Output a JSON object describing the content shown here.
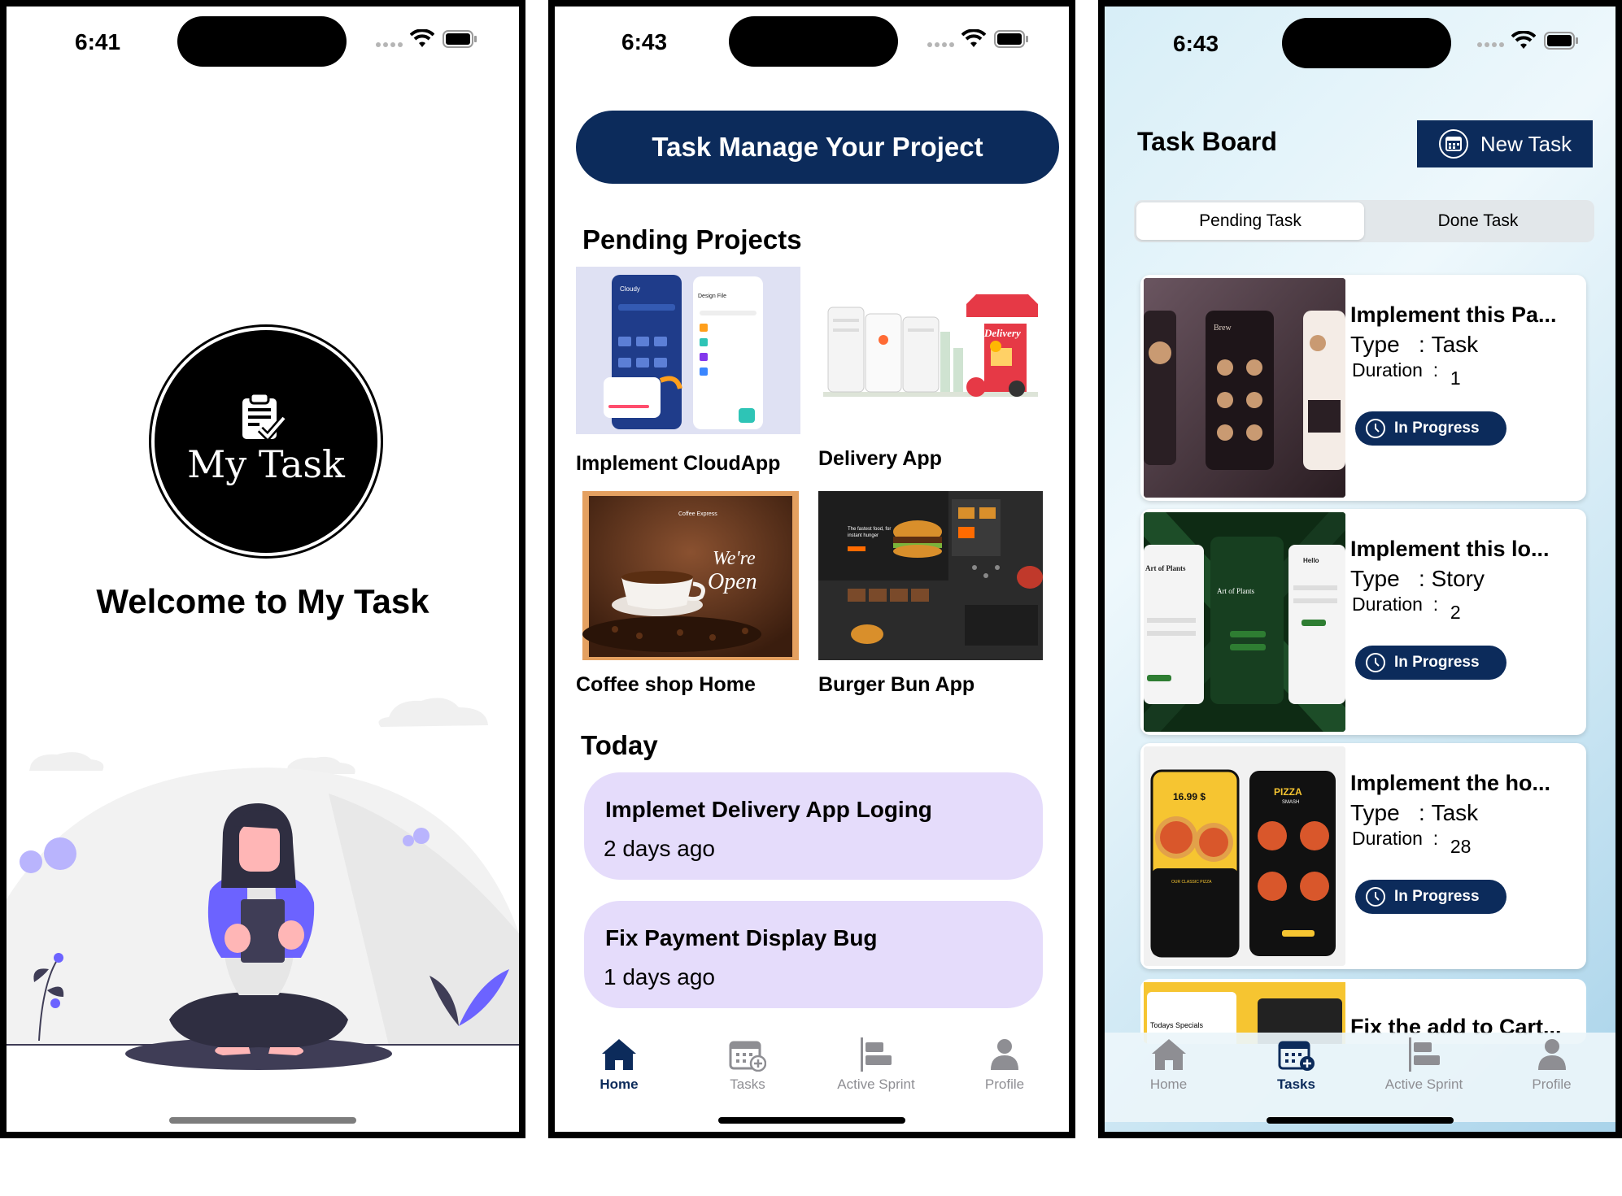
{
  "phones": [
    {
      "status_time": "6:41",
      "logo_text": "My Task",
      "welcome": "Welcome to My Task"
    },
    {
      "status_time": "6:43",
      "banner": "Task Manage Your Project",
      "pending_title": "Pending Projects",
      "projects": [
        {
          "name": "Implement CloudApp"
        },
        {
          "name": "Delivery App"
        },
        {
          "name": "Coffee shop Home"
        },
        {
          "name": "Burger Bun App"
        }
      ],
      "thumb_text": {
        "cloud_brand": "Cloudy",
        "cloud_file": "Design File",
        "coffee_brand": "Coffee Express",
        "we_re": "We're",
        "open": "Open",
        "delivery_sign": "Delivery",
        "burger_head1": "The fastest food, for",
        "burger_head2": "instant hunger"
      },
      "today_title": "Today",
      "today_items": [
        {
          "title": "Implemet Delivery App Loging",
          "ago": "2 days ago"
        },
        {
          "title": "Fix Payment Display Bug",
          "ago": "1 days ago"
        }
      ],
      "tabs": [
        {
          "label": "Home"
        },
        {
          "label": "Tasks"
        },
        {
          "label": "Active Sprint"
        },
        {
          "label": "Profile"
        }
      ]
    },
    {
      "status_time": "6:43",
      "board_title": "Task Board",
      "new_task": "New Task",
      "segments": [
        "Pending Task",
        "Done Task"
      ],
      "type_label": "Type",
      "duration_label": "Duration",
      "tasks": [
        {
          "title": "Implement this Pa...",
          "type": "Task",
          "duration": "1",
          "status": "In Progress"
        },
        {
          "title": "Implement this lo...",
          "type": "Story",
          "duration": "2",
          "status": "In Progress"
        },
        {
          "title": "Implement the ho...",
          "type": "Task",
          "duration": "28",
          "status": "In Progress"
        }
      ],
      "partial_task": {
        "title": "Fix the add to Cart...",
        "thumb_text": "Todays Specials"
      },
      "thumb_text": {
        "brew": "Brew",
        "plants": "Art of Plants",
        "hello": "Hello",
        "price": "16.99 $",
        "pizza": "PIZZA",
        "smash": "SMASH",
        "classic": "OUR CLASSIC PIZZA"
      },
      "tabs": [
        {
          "label": "Home"
        },
        {
          "label": "Tasks"
        },
        {
          "label": "Active Sprint"
        },
        {
          "label": "Profile"
        }
      ]
    }
  ],
  "colors": {
    "navy": "#0c2b5b",
    "lavender": "#e5dcfb",
    "illustration_purple": "#6c63ff",
    "tab_active": "#0c2b5b",
    "tab_inactive": "#8e8e93"
  },
  "icons": [
    "clipboard-check-icon",
    "wifi-icon",
    "battery-icon",
    "home-icon",
    "calendar-add-icon",
    "sprint-icon",
    "person-icon",
    "calendar-icon",
    "clock-icon"
  ]
}
